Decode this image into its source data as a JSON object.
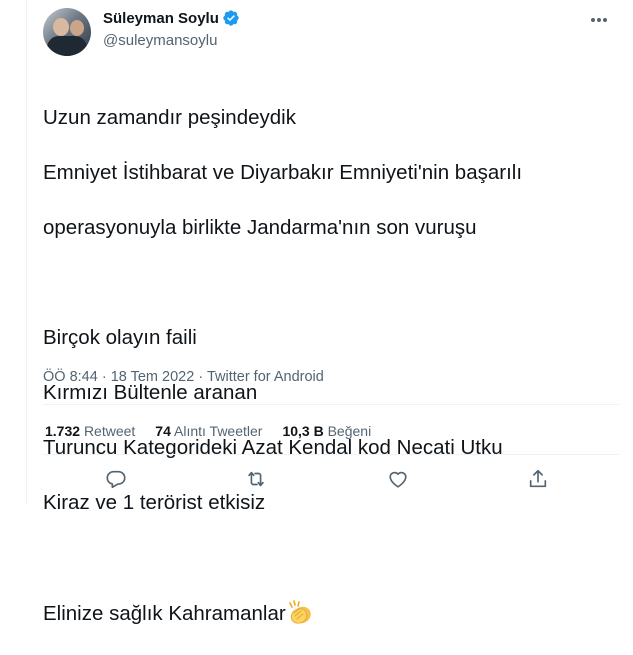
{
  "author": {
    "display_name": "Süleyman Soylu",
    "handle": "@suleymansoylu",
    "verified": true
  },
  "tweet": {
    "lines": [
      "Uzun zamandır peşindeydik",
      "Emniyet İstihbarat ve Diyarbakır Emniyeti'nin başarılı",
      "operasyonuyla birlikte Jandarma'nın son vuruşu",
      "",
      "Birçok olayın faili",
      "Kırmızı Bültenle aranan",
      "Turuncu Kategorideki Azat Kendal kod Necati Utku",
      "Kiraz ve 1 terörist etkisiz",
      "",
      "Elinize sağlık Kahramanlar"
    ],
    "emoji": "clapping-hands"
  },
  "meta": {
    "time": "ÖÖ 8:44",
    "separator": "·",
    "date": "18 Tem 2022",
    "source": "Twitter for Android"
  },
  "stats": {
    "retweets_count": "1.732",
    "retweets_label": "Retweet",
    "quotes_count": "74",
    "quotes_label": "Alıntı Tweetler",
    "likes_count": "10,3 B",
    "likes_label": "Beğeni"
  },
  "icons": {
    "verified": "verified-badge-icon",
    "more": "more-icon",
    "reply": "reply-icon",
    "retweet": "retweet-icon",
    "like": "like-icon",
    "share": "share-icon"
  },
  "colors": {
    "text": "#0f1419",
    "secondary": "#536471",
    "verified": "#1d9bf0",
    "divider": "#eff3f4"
  }
}
